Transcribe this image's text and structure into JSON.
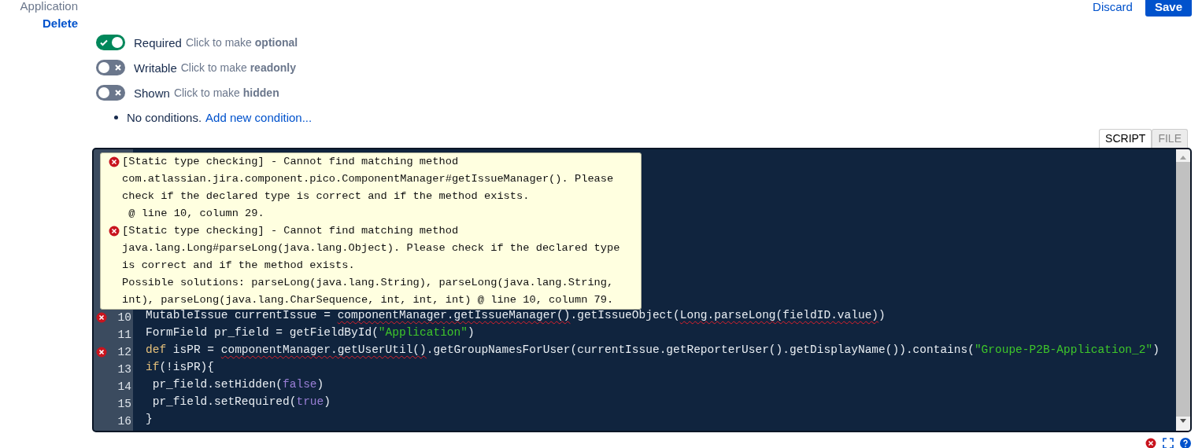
{
  "field": {
    "name": "Application",
    "delete_link": "Delete"
  },
  "actions": {
    "discard_link": "Discard",
    "save_button": "Save"
  },
  "toggles": [
    {
      "label": "Required",
      "hint": "Click to make **optional**",
      "on": true
    },
    {
      "label": "Writable",
      "hint": "Click to make **readonly**",
      "on": false
    },
    {
      "label": "Shown",
      "hint": "Click to make **hidden**",
      "on": false
    }
  ],
  "conditions": {
    "text": "No conditions.",
    "link": "Add new condition..."
  },
  "editor_tabs": [
    {
      "label": "SCRIPT",
      "selected": true
    },
    {
      "label": "FILE",
      "selected": false
    }
  ],
  "error_tooltip": [
    {
      "message": "[Static type checking] - Cannot find matching method\ncom.atlassian.jira.component.pico.ComponentManager#getIssueManager(). Please\ncheck if the declared type is correct and if the method exists.\n @ line 10, column 29."
    },
    {
      "message": "[Static type checking] - Cannot find matching method\njava.lang.Long#parseLong(java.lang.Object). Please check if the declared type\nis correct and if the method exists.\nPossible solutions: parseLong(java.lang.String), parseLong(java.lang.String,\nint), parseLong(java.lang.CharSequence, int, int, int) @ line 10, column 79."
    }
  ],
  "code_lines": [
    {
      "number": "10",
      "error": true,
      "tokens": [
        {
          "text": "MutableIssue currentIssue = ",
          "kind": "plain",
          "squiggle": false
        },
        {
          "text": "componentManager.getIssueManager()",
          "kind": "plain",
          "squiggle": true
        },
        {
          "text": ".getIssueObject(",
          "kind": "plain",
          "squiggle": false
        },
        {
          "text": "Long.parseLong(fieldID.value)",
          "kind": "plain",
          "squiggle": true
        },
        {
          "text": ")",
          "kind": "plain",
          "squiggle": false
        }
      ]
    },
    {
      "number": "11",
      "error": false,
      "tokens": [
        {
          "text": "FormField pr_field = getFieldById(",
          "kind": "plain",
          "squiggle": false
        },
        {
          "text": "\"Application\"",
          "kind": "string",
          "squiggle": false
        },
        {
          "text": ")",
          "kind": "plain",
          "squiggle": false
        }
      ]
    },
    {
      "number": "12",
      "error": true,
      "tokens": [
        {
          "text": "def",
          "kind": "keyword",
          "squiggle": false
        },
        {
          "text": " isPR = ",
          "kind": "plain",
          "squiggle": false
        },
        {
          "text": "componentManager.getUserUtil()",
          "kind": "plain",
          "squiggle": true
        },
        {
          "text": ".getGroupNamesForUser(currentIssue.getReporterUser().getDisplayName()).contains(",
          "kind": "plain",
          "squiggle": false
        },
        {
          "text": "\"Groupe-P2B-Application_2\"",
          "kind": "string",
          "squiggle": false
        },
        {
          "text": ")",
          "kind": "plain",
          "squiggle": false
        }
      ]
    },
    {
      "number": "13",
      "error": false,
      "tokens": [
        {
          "text": "if",
          "kind": "keyword",
          "squiggle": false
        },
        {
          "text": "(!isPR){",
          "kind": "plain",
          "squiggle": false
        }
      ]
    },
    {
      "number": "14",
      "error": false,
      "tokens": [
        {
          "text": " pr_field.setHidden(",
          "kind": "plain",
          "squiggle": false
        },
        {
          "text": "false",
          "kind": "literal",
          "squiggle": false
        },
        {
          "text": ")",
          "kind": "plain",
          "squiggle": false
        }
      ]
    },
    {
      "number": "15",
      "error": false,
      "tokens": [
        {
          "text": " pr_field.setRequired(",
          "kind": "plain",
          "squiggle": false
        },
        {
          "text": "true",
          "kind": "literal",
          "squiggle": false
        },
        {
          "text": ")",
          "kind": "plain",
          "squiggle": false
        }
      ]
    },
    {
      "number": "16",
      "error": false,
      "tokens": [
        {
          "text": "}",
          "kind": "plain",
          "squiggle": false
        }
      ]
    }
  ]
}
